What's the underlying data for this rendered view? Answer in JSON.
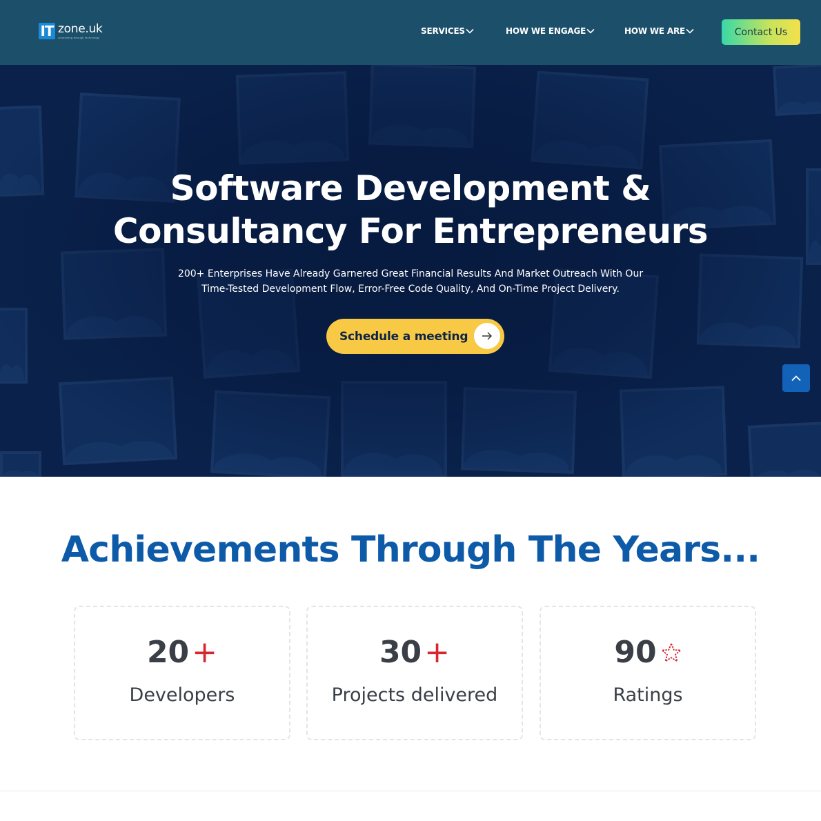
{
  "header": {
    "logo_mark": "IT",
    "logo_text": "zone.uk",
    "logo_tagline": "connecting through technology",
    "nav": [
      {
        "label": "SERVICES"
      },
      {
        "label": "HOW WE ENGAGE"
      },
      {
        "label": "HOW WE ARE"
      }
    ],
    "contact_label": "Contact Us"
  },
  "hero": {
    "title_line1": "Software Development &",
    "title_line2": "Consultancy For Entrepreneurs",
    "subtitle_line1": "200+ Enterprises Have Already Garnered Great Financial Results And Market Outreach With Our",
    "subtitle_line2": "Time-Tested Development Flow, Error-Free Code Quality, And On-Time Project Delivery.",
    "cta_label": "Schedule a meeting"
  },
  "achievements": {
    "title": "Achievements Through The Years...",
    "stats": [
      {
        "value": "20",
        "suffix": "+",
        "label": "Developers"
      },
      {
        "value": "30",
        "suffix": "+",
        "label": "Projects delivered"
      },
      {
        "value": "90",
        "suffix": "star",
        "label": "Ratings"
      }
    ]
  },
  "icons": {
    "nav_dropdown": "chevron-down-icon",
    "cta_arrow": "arrow-right-icon",
    "scroll_top": "chevron-up-icon",
    "rating": "star-icon"
  },
  "colors": {
    "header_bg": "#1c4f6a",
    "hero_bg": "#0b2550",
    "cta_yellow": "#f8c944",
    "title_blue": "#0d5ba8",
    "accent_red": "#d7262c",
    "scroll_btn": "#1262b8"
  }
}
